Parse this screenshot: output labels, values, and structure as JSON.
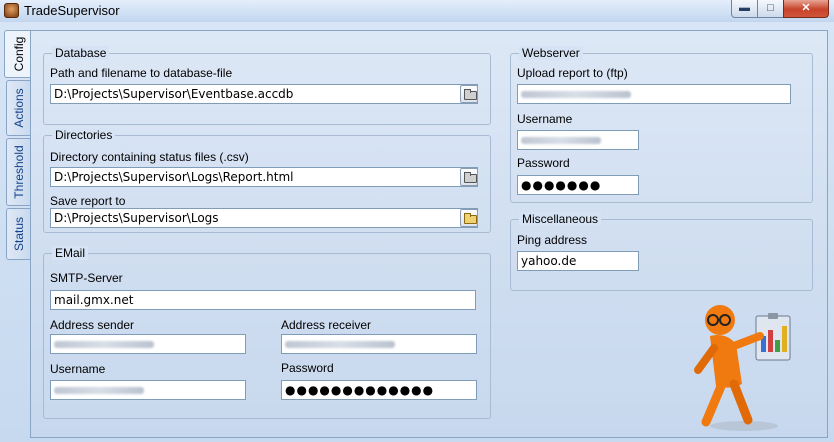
{
  "window": {
    "title": "TradeSupervisor"
  },
  "tabs": [
    {
      "label": "Config",
      "active": true
    },
    {
      "label": "Actions",
      "active": false
    },
    {
      "label": "Threshold",
      "active": false
    },
    {
      "label": "Status",
      "active": false
    }
  ],
  "database": {
    "legend": "Database",
    "path_label": "Path and filename to database-file",
    "path_value": "D:\\Projects\\Supervisor\\Eventbase.accdb"
  },
  "directories": {
    "legend": "Directories",
    "status_label": "Directory containing status files (.csv)",
    "status_value": "D:\\Projects\\Supervisor\\Logs\\Report.html",
    "report_label": "Save report to",
    "report_value": "D:\\Projects\\Supervisor\\Logs"
  },
  "email": {
    "legend": "EMail",
    "smtp_label": "SMTP-Server",
    "smtp_value": "mail.gmx.net",
    "sender_label": "Address sender",
    "receiver_label": "Address receiver",
    "username_label": "Username",
    "password_label": "Password",
    "password_value": "●●●●●●●●●●●●●"
  },
  "webserver": {
    "legend": "Webserver",
    "upload_label": "Upload report to (ftp)",
    "username_label": "Username",
    "password_label": "Password",
    "password_value": "●●●●●●●"
  },
  "misc": {
    "legend": "Miscellaneous",
    "ping_label": "Ping address",
    "ping_value": "yahoo.de"
  },
  "colors": {
    "tab_text": "#15428b",
    "field_border": "#7f9db9",
    "mascot": "#f07a10"
  }
}
